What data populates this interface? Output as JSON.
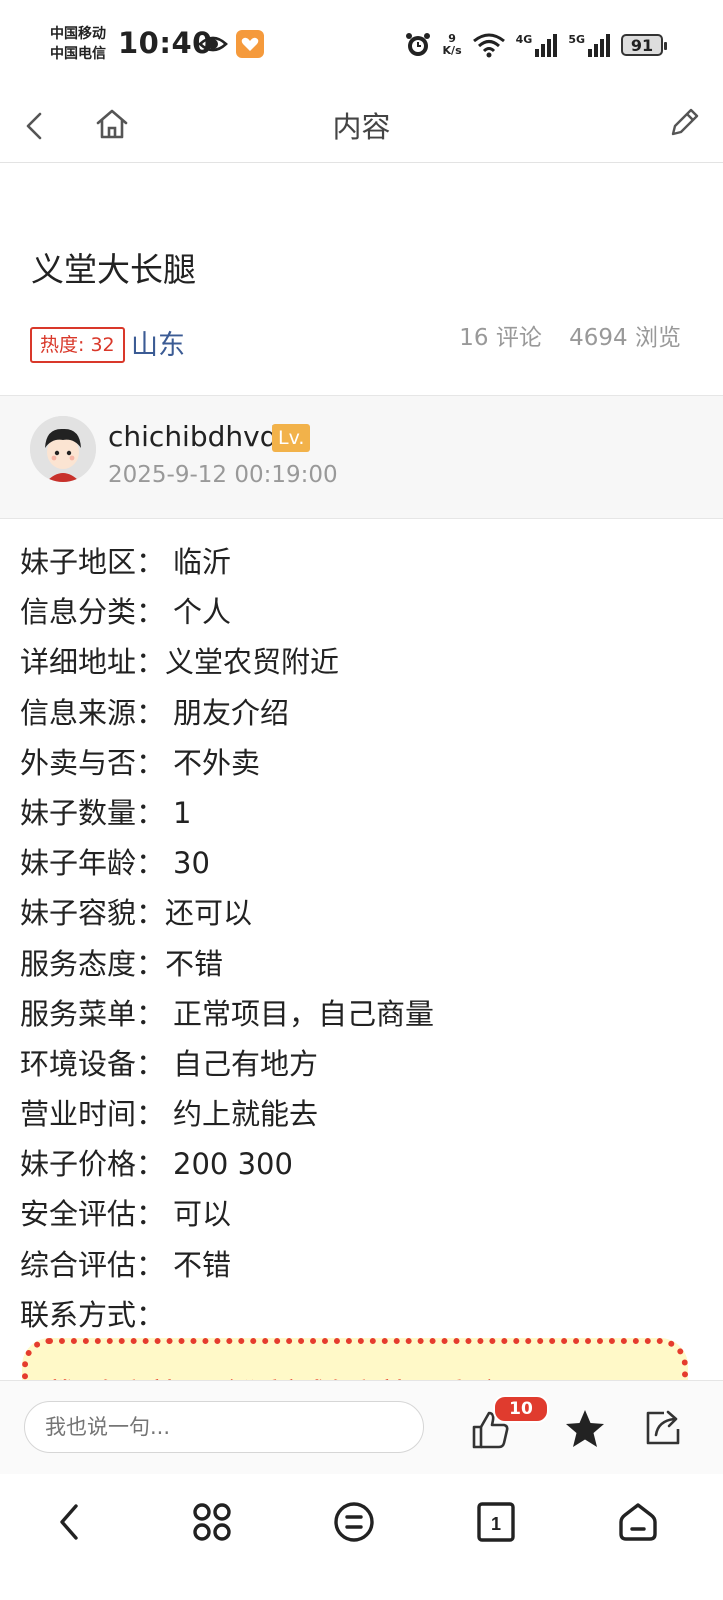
{
  "status_bar": {
    "carrier1": "中国移动",
    "carrier2": "中国电信",
    "time": "10:40",
    "speed_value": "9",
    "speed_unit": "K/s",
    "net1": "4G",
    "net2": "5G",
    "battery": "91",
    "app_icon_color": "#f59a3c"
  },
  "nav": {
    "title": "内容"
  },
  "post": {
    "title": "义堂大长腿",
    "heat": "热度: 32",
    "region": "山东",
    "comments": "16 评论",
    "views": "4694 浏览"
  },
  "author": {
    "name": "chichibdhvd",
    "level": "Lv.",
    "time": "2025-9-12 00:19:00"
  },
  "info": [
    {
      "key": "妹子地区：",
      "value": "临沂"
    },
    {
      "key": "信息分类：",
      "value": "个人"
    },
    {
      "key": "详细地址：",
      "value": "义堂农贸附近"
    },
    {
      "key": "信息来源：",
      "value": "朋友介绍"
    },
    {
      "key": "外卖与否：",
      "value": "不外卖"
    },
    {
      "key": "妹子数量：",
      "value": "1"
    },
    {
      "key": "妹子年龄：",
      "value": "30"
    },
    {
      "key": "妹子容貌：",
      "value": "还可以"
    },
    {
      "key": "服务态度：",
      "value": "不错"
    },
    {
      "key": "服务菜单：",
      "value": "正常项目，自己商量"
    },
    {
      "key": "环境设备：",
      "value": "自己有地方"
    },
    {
      "key": "营业时间：",
      "value": "约上就能去"
    },
    {
      "key": "妹子价格：",
      "value": "200 300"
    },
    {
      "key": "安全评估：",
      "value": "可以"
    },
    {
      "key": "综合评估：",
      "value": "不错"
    },
    {
      "key": "联系方式：",
      "value": ""
    }
  ],
  "notice": {
    "text": "楼层有防骗提示（联系方式有防骗提示看下）"
  },
  "comment_bar": {
    "placeholder": "我也说一句...",
    "like_count": "10"
  },
  "colors": {
    "accent_red": "#e03b2e",
    "region_blue": "#3b5b94",
    "level_gold": "#f2b24a"
  }
}
